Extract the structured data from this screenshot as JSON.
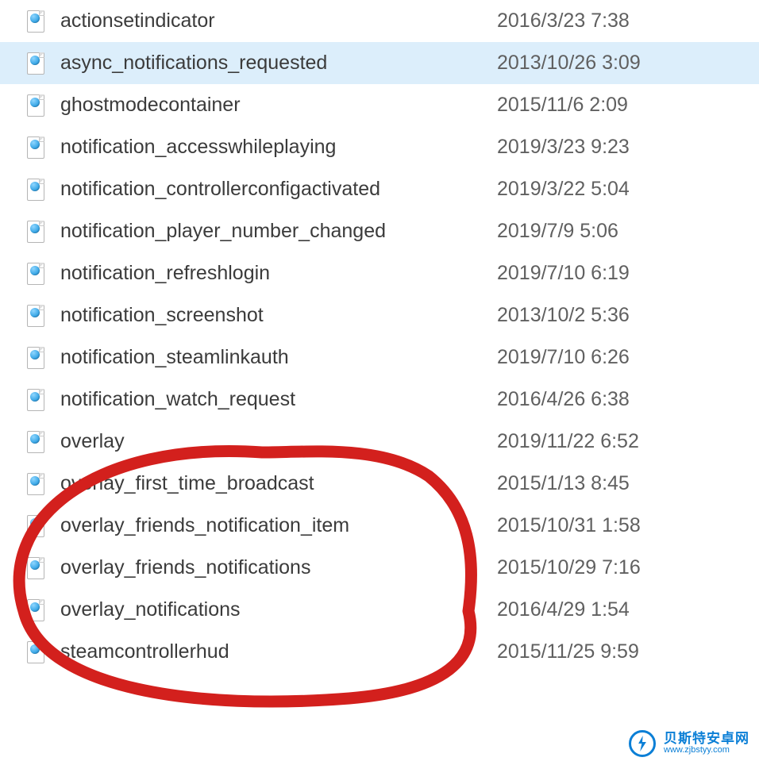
{
  "files": [
    {
      "name": "actionsetindicator",
      "date": "2016/3/23 7:38",
      "selected": false
    },
    {
      "name": "async_notifications_requested",
      "date": "2013/10/26 3:09",
      "selected": true
    },
    {
      "name": "ghostmodecontainer",
      "date": "2015/11/6 2:09",
      "selected": false
    },
    {
      "name": "notification_accesswhileplaying",
      "date": "2019/3/23 9:23",
      "selected": false
    },
    {
      "name": "notification_controllerconfigactivated",
      "date": "2019/3/22 5:04",
      "selected": false
    },
    {
      "name": "notification_player_number_changed",
      "date": "2019/7/9 5:06",
      "selected": false
    },
    {
      "name": "notification_refreshlogin",
      "date": "2019/7/10 6:19",
      "selected": false
    },
    {
      "name": "notification_screenshot",
      "date": "2013/10/2 5:36",
      "selected": false
    },
    {
      "name": "notification_steamlinkauth",
      "date": "2019/7/10 6:26",
      "selected": false
    },
    {
      "name": "notification_watch_request",
      "date": "2016/4/26 6:38",
      "selected": false
    },
    {
      "name": "overlay",
      "date": "2019/11/22 6:52",
      "selected": false
    },
    {
      "name": "overlay_first_time_broadcast",
      "date": "2015/1/13 8:45",
      "selected": false
    },
    {
      "name": "overlay_friends_notification_item",
      "date": "2015/10/31 1:58",
      "selected": false
    },
    {
      "name": "overlay_friends_notifications",
      "date": "2015/10/29 7:16",
      "selected": false
    },
    {
      "name": "overlay_notifications",
      "date": "2016/4/29 1:54",
      "selected": false
    },
    {
      "name": "steamcontrollerhud",
      "date": "2015/11/25 9:59",
      "selected": false
    }
  ],
  "watermark": {
    "cn": "贝斯特安卓网",
    "url": "www.zjbstyy.com"
  }
}
